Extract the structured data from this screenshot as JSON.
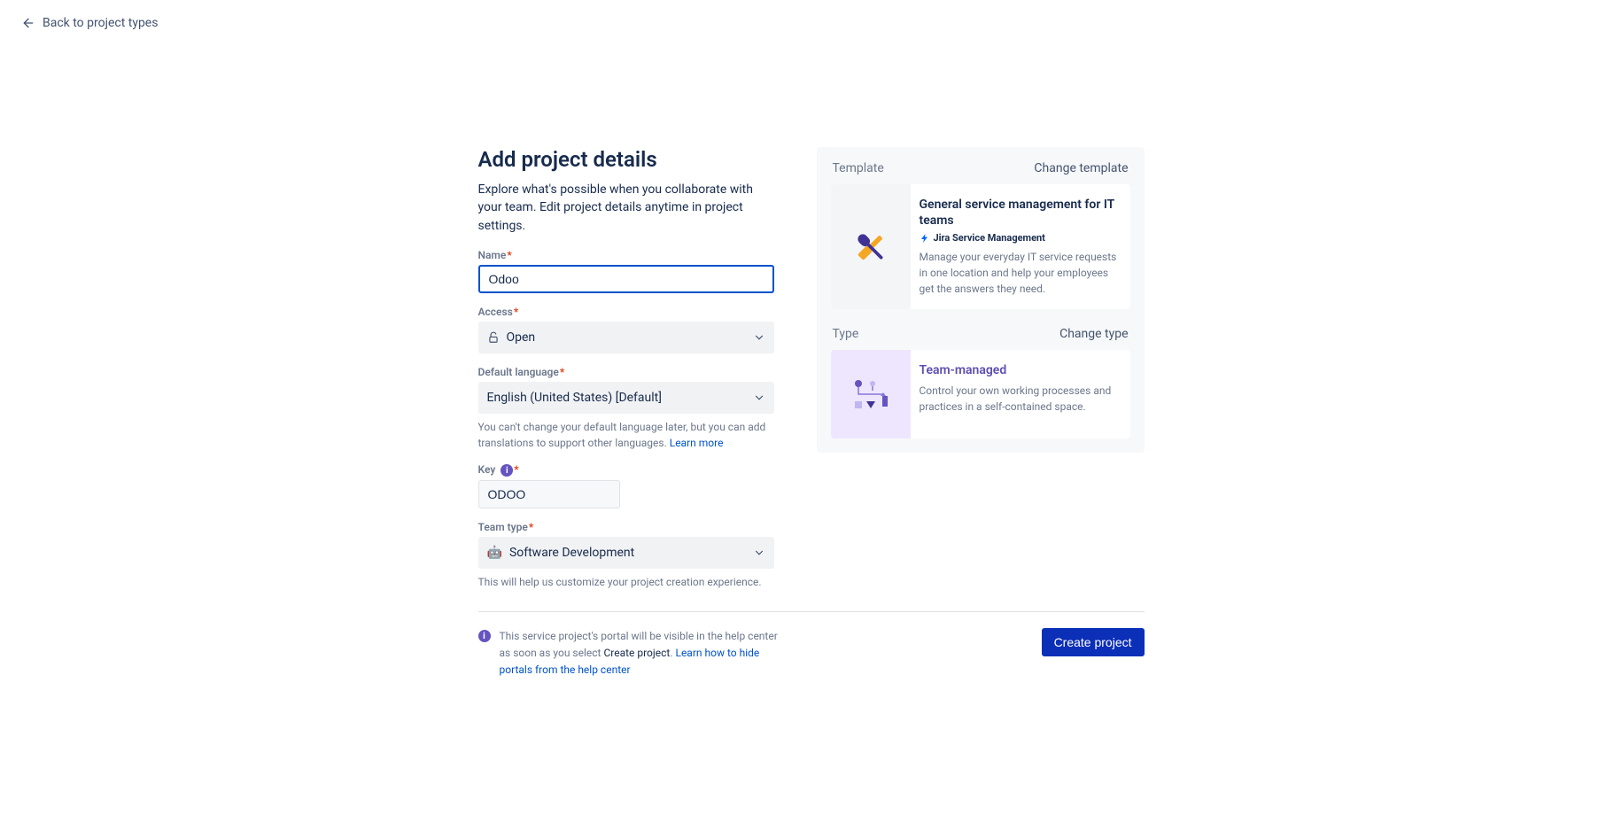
{
  "back_label": "Back to project types",
  "page_title": "Add project details",
  "page_subtitle": "Explore what's possible when you collaborate with your team. Edit project details anytime in project settings.",
  "form": {
    "name_label": "Name",
    "name_value": "Odoo",
    "access_label": "Access",
    "access_value": "Open",
    "language_label": "Default language",
    "language_value": "English (United States) [Default]",
    "language_helper_pre": "You can't change your default language later, but you can add translations to support other languages. ",
    "language_helper_link": "Learn more",
    "key_label": "Key",
    "key_value": "ODOO",
    "teamtype_label": "Team type",
    "teamtype_value": "Software Development",
    "teamtype_helper": "This will help us customize your project creation experience."
  },
  "template_panel": {
    "label": "Template",
    "change_label": "Change template",
    "card_title": "General service management for IT teams",
    "card_product": "Jira Service Management",
    "card_desc": "Manage your everyday IT service requests in one location and help your employees get the answers they need."
  },
  "type_panel": {
    "label": "Type",
    "change_label": "Change type",
    "card_title": "Team-managed",
    "card_desc": "Control your own working processes and practices in a self-contained space."
  },
  "footer": {
    "info_pre": "This service project's portal will be visible in the help center as soon as you select ",
    "info_bold": "Create project",
    "info_post": ". ",
    "info_link": "Learn how to hide portals from the help center",
    "create_label": "Create project"
  }
}
